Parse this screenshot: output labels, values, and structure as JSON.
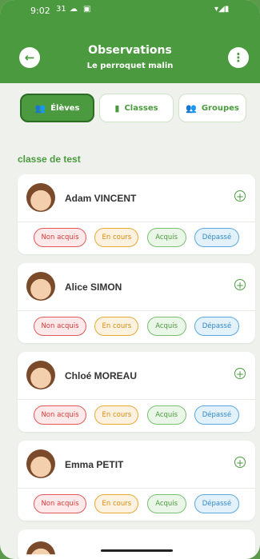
{
  "status_bar": {
    "time": "9:02",
    "calendar_icon": "31",
    "signal_icons": "▾◢▮"
  },
  "app_bar": {
    "title": "Observations",
    "subtitle": "Le perroquet malin",
    "back_icon": "arrow-left-icon",
    "more_icon": "vertical-dots-icon"
  },
  "tabs": [
    {
      "label": "Élèves",
      "icon": "people-icon",
      "active": true
    },
    {
      "label": "Classes",
      "icon": "book-icon",
      "active": false
    },
    {
      "label": "Groupes",
      "icon": "people-icon",
      "active": false
    }
  ],
  "section": {
    "title": "classe de test"
  },
  "students": [
    {
      "name": "Adam VINCENT"
    },
    {
      "name": "Alice SIMON"
    },
    {
      "name": "Chloé MOREAU"
    },
    {
      "name": "Emma PETIT"
    }
  ],
  "chips": {
    "non_acquis": "Non acquis",
    "en_cours": "En cours",
    "acquis": "Acquis",
    "depasse": "Dépassé"
  },
  "colors": {
    "primary": "#4b9a3f",
    "background": "#eef1ec"
  }
}
